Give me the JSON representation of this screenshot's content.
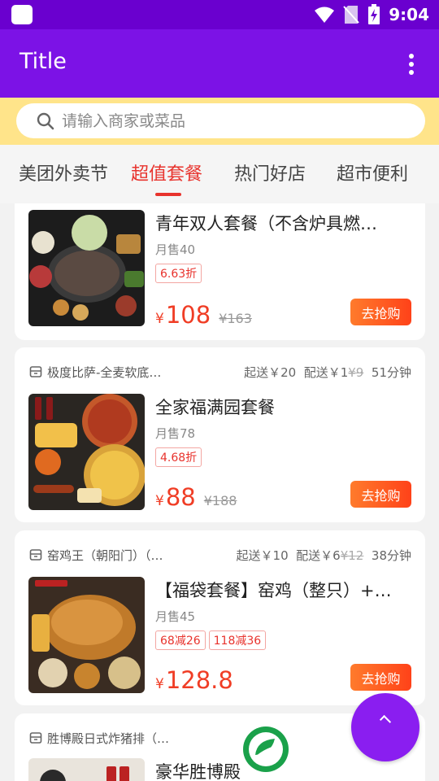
{
  "status_bar": {
    "time": "9:04"
  },
  "app_bar": {
    "title": "Title",
    "more_icon": "more-vert-icon"
  },
  "search": {
    "placeholder": "请输入商家或菜品",
    "icon": "search-icon"
  },
  "tabs": [
    {
      "label": "美团外卖节",
      "active": false
    },
    {
      "label": "超值套餐",
      "active": true
    },
    {
      "label": "热门好店",
      "active": false
    },
    {
      "label": "超市便利",
      "active": false
    }
  ],
  "deals": [
    {
      "store": null,
      "title": "青年双人套餐（不含炉具燃…",
      "sales": "月售40",
      "badges": [
        "6.63折"
      ],
      "price_symbol": "¥",
      "price": "108",
      "original_price": "¥163",
      "buy_label": "去抢购"
    },
    {
      "store": {
        "name": "极度比萨-全麦软底…",
        "min_order": "起送￥20",
        "delivery_prefix": "配送￥1",
        "delivery_original": "¥9",
        "time": "51分钟"
      },
      "title": "全家福满园套餐",
      "sales": "月售78",
      "badges": [
        "4.68折"
      ],
      "price_symbol": "¥",
      "price": "88",
      "original_price": "¥188",
      "buy_label": "去抢购"
    },
    {
      "store": {
        "name": "窑鸡王（朝阳门）（…",
        "min_order": "起送￥10",
        "delivery_prefix": "配送￥6",
        "delivery_original": "¥12",
        "time": "38分钟"
      },
      "title": "【福袋套餐】窑鸡（整只）+…",
      "sales": "月售45",
      "badges": [
        "68减26",
        "118减36"
      ],
      "price_symbol": "¥",
      "price": "128.8",
      "original_price": "",
      "buy_label": "去抢购"
    },
    {
      "store": {
        "name": "胜博殿日式炸猪排（…"
      },
      "title": "豪华胜博殿"
    }
  ],
  "colors": {
    "status_bar": "#6a00cf",
    "app_bar": "#7c12e6",
    "search_strip": "#ffe48a",
    "accent_red": "#e8332d",
    "price_orange": "#f03d25",
    "fab": "#8a1ef0"
  }
}
